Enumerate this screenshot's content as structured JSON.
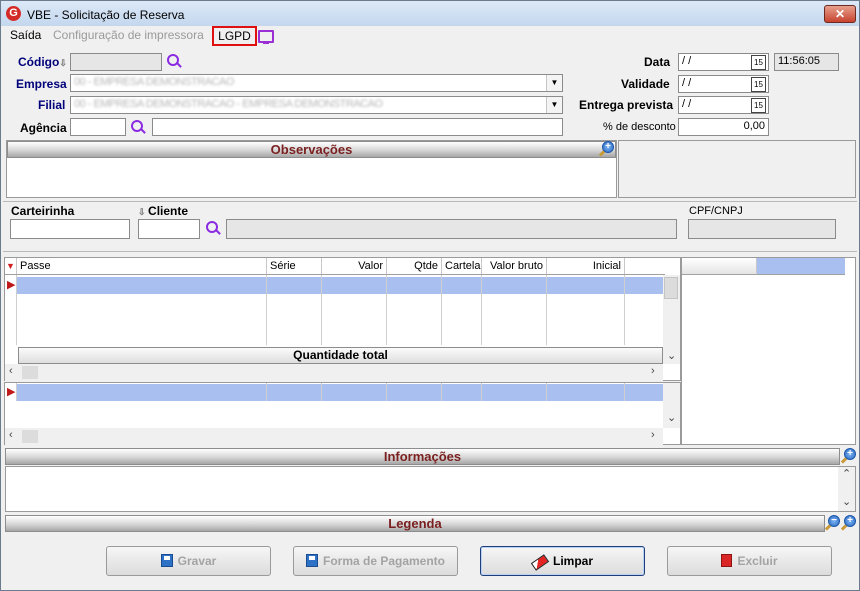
{
  "window": {
    "title": "VBE - Solicitação de Reserva",
    "close_glyph": "✕",
    "logo_letter": "G"
  },
  "menu": {
    "saida": "Saída",
    "config_impressora": "Configuração de impressora",
    "lgpd": "LGPD"
  },
  "form": {
    "codigo_label": "Código",
    "empresa_label": "Empresa",
    "empresa_value": "00 - EMPRESA DEMONSTRACAO",
    "filial_label": "Filial",
    "filial_value": "00 - EMPRESA DEMONSTRACAO - EMPRESA DEMONSTRACAO",
    "agencia_label": "Agência",
    "data_label": "Data",
    "data_value": "/ /",
    "time_value": "11:56:05",
    "validade_label": "Validade",
    "validade_value": "/ /",
    "entrega_label": "Entrega prevista",
    "entrega_value": "/ /",
    "desconto_label": "% de desconto",
    "desconto_value": "0,00",
    "cal_glyph": "15"
  },
  "observacoes": {
    "title": "Observações"
  },
  "cliente": {
    "carteirinha_label": "Carteirinha",
    "cliente_label": "Cliente",
    "cpf_label": "CPF/CNPJ"
  },
  "grid": {
    "columns": [
      "Passe",
      "Série",
      "Valor",
      "Qtde",
      "Cartela",
      "Valor bruto",
      "Inicial"
    ],
    "total_label": "Quantidade total"
  },
  "informacoes": {
    "title": "Informações"
  },
  "legenda": {
    "title": "Legenda"
  },
  "buttons": {
    "gravar": "Gravar",
    "forma_pagamento": "Forma de Pagamento",
    "limpar": "Limpar",
    "excluir": "Excluir"
  },
  "colors": {
    "selected_row": "#a9bff0",
    "header_text": "#7a1f1f",
    "label_blue": "#00007a"
  }
}
